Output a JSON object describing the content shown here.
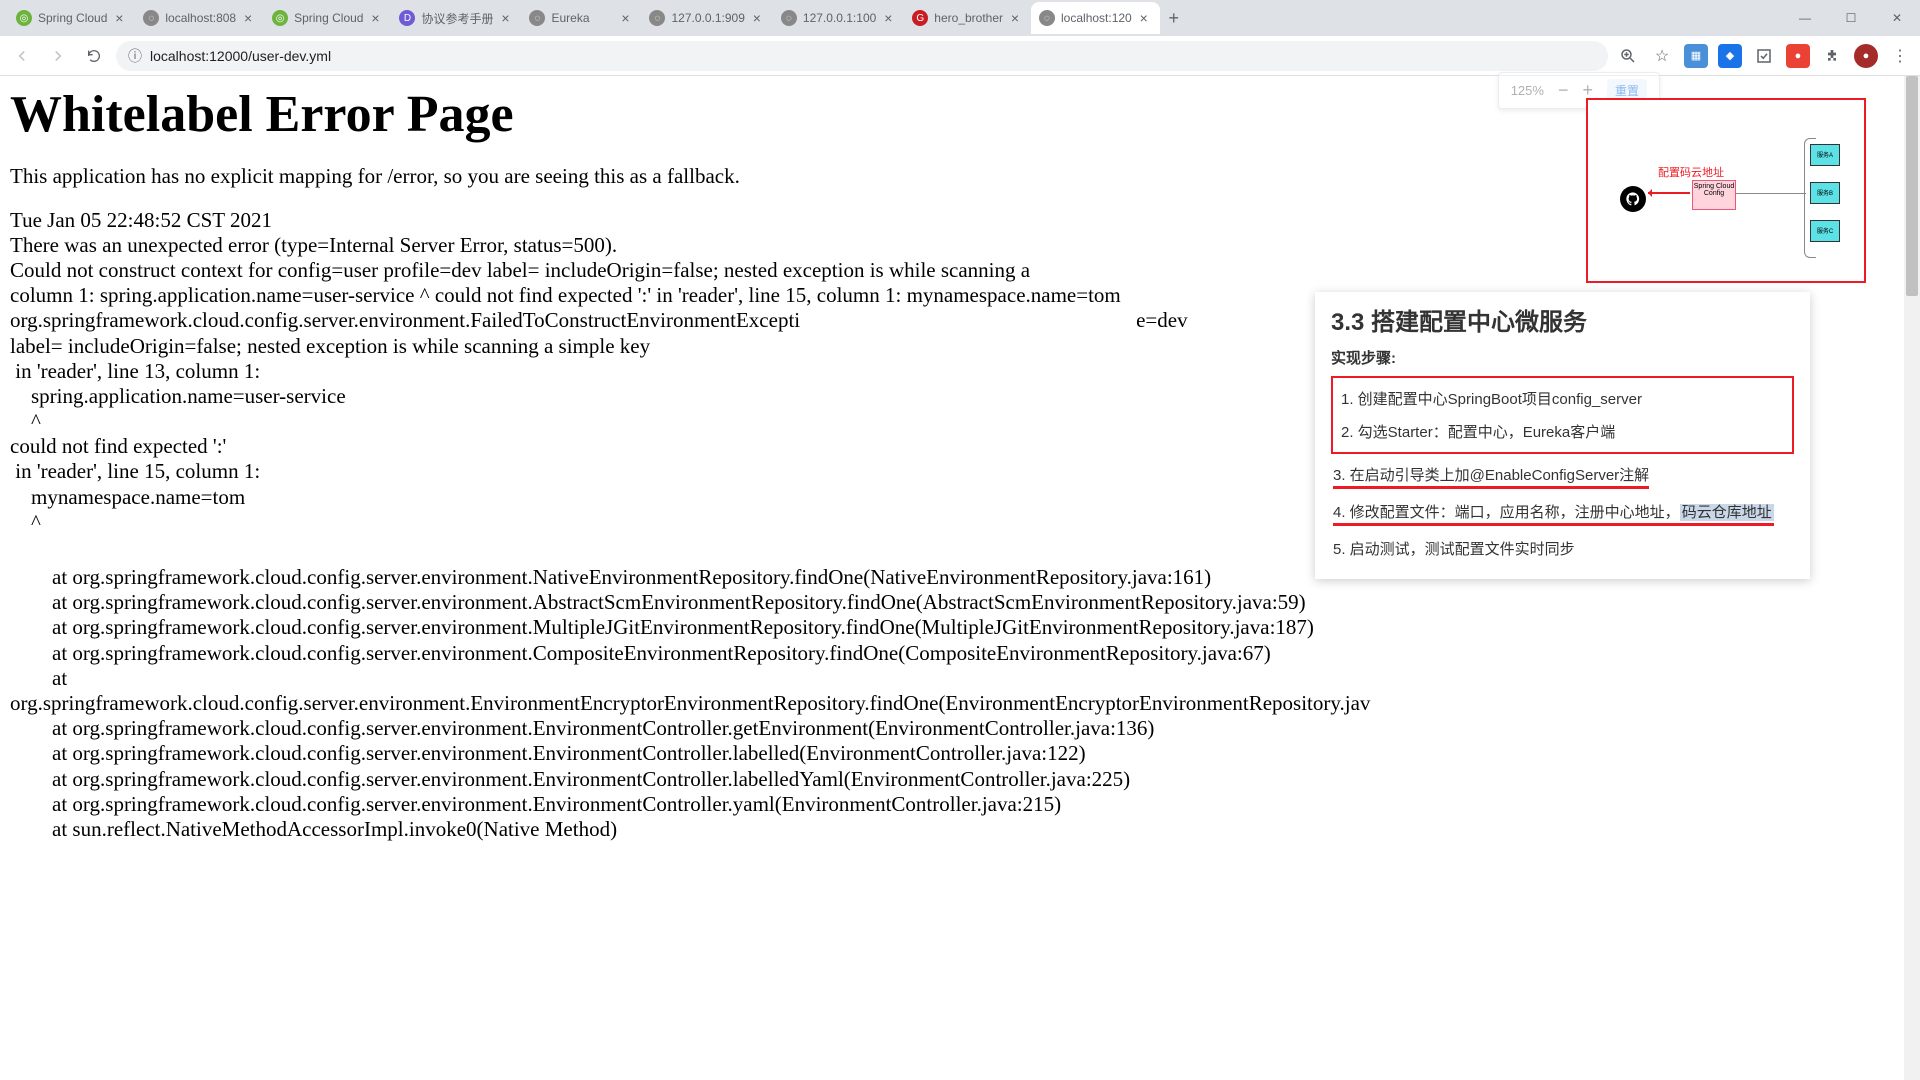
{
  "tabs": [
    {
      "title": "Spring Cloud",
      "icon_bg": "#6db33f",
      "icon_text": "◎"
    },
    {
      "title": "localhost:808",
      "icon_bg": "#888",
      "icon_text": "◌"
    },
    {
      "title": "Spring Cloud",
      "icon_bg": "#6db33f",
      "icon_text": "◎"
    },
    {
      "title": "协议参考手册",
      "icon_bg": "#6e5bd6",
      "icon_text": "D"
    },
    {
      "title": "Eureka",
      "icon_bg": "#888",
      "icon_text": "◌"
    },
    {
      "title": "127.0.0.1:909",
      "icon_bg": "#888",
      "icon_text": "◌"
    },
    {
      "title": "127.0.0.1:100",
      "icon_bg": "#888",
      "icon_text": "◌"
    },
    {
      "title": "hero_brother",
      "icon_bg": "#c71d23",
      "icon_text": "G"
    },
    {
      "title": "localhost:120",
      "icon_bg": "#888",
      "icon_text": "◌",
      "active": true
    }
  ],
  "url": "localhost:12000/user-dev.yml",
  "zoom": {
    "value": "125%",
    "reset": "重置"
  },
  "page": {
    "title": "Whitelabel Error Page",
    "fallback": "This application has no explicit mapping for /error, so you are seeing this as a fallback.",
    "timestamp": "Tue Jan 05 22:48:52 CST 2021",
    "error_main": "There was an unexpected error (type=Internal Server Error, status=500).\nCould not construct context for config=user profile=dev label= includeOrigin=false; nested exception is while scanning a\ncolumn 1: spring.application.name=user-service ^ could not find expected ':' in 'reader', line 15, column 1: mynamespace.name=tom\norg.springframework.cloud.config.server.environment.FailedToConstructEnvironmentExcepti                                                                e=dev\nlabel= includeOrigin=false; nested exception is while scanning a simple key\n in 'reader', line 13, column 1:\n    spring.application.name=user-service\n    ^\ncould not find expected ':'\n in 'reader', line 15, column 1:\n    mynamespace.name=tom\n    ^",
    "stack": "        at org.springframework.cloud.config.server.environment.NativeEnvironmentRepository.findOne(NativeEnvironmentRepository.java:161)\n        at org.springframework.cloud.config.server.environment.AbstractScmEnvironmentRepository.findOne(AbstractScmEnvironmentRepository.java:59)\n        at org.springframework.cloud.config.server.environment.MultipleJGitEnvironmentRepository.findOne(MultipleJGitEnvironmentRepository.java:187)\n        at org.springframework.cloud.config.server.environment.CompositeEnvironmentRepository.findOne(CompositeEnvironmentRepository.java:67)\n        at\norg.springframework.cloud.config.server.environment.EnvironmentEncryptorEnvironmentRepository.findOne(EnvironmentEncryptorEnvironmentRepository.jav\n        at org.springframework.cloud.config.server.environment.EnvironmentController.getEnvironment(EnvironmentController.java:136)\n        at org.springframework.cloud.config.server.environment.EnvironmentController.labelled(EnvironmentController.java:122)\n        at org.springframework.cloud.config.server.environment.EnvironmentController.labelledYaml(EnvironmentController.java:225)\n        at org.springframework.cloud.config.server.environment.EnvironmentController.yaml(EnvironmentController.java:215)\n        at sun.reflect.NativeMethodAccessorImpl.invoke0(Native Method)"
  },
  "diagram": {
    "label": "配置码云地址",
    "services": [
      "服务A",
      "服务B",
      "服务C"
    ]
  },
  "notes": {
    "title": "3.3 搭建配置中心微服务",
    "subtitle": "实现步骤:",
    "items": [
      "1. 创建配置中心SpringBoot项目config_server",
      "2. 勾选Starter：配置中心，Eureka客户端",
      "3. 在启动引导类上加@EnableConfigServer注解",
      "4. 修改配置文件：端口，应用名称，注册中心地址，",
      "5. 启动测试，测试配置文件实时同步"
    ],
    "highlight": "码云仓库地址"
  }
}
